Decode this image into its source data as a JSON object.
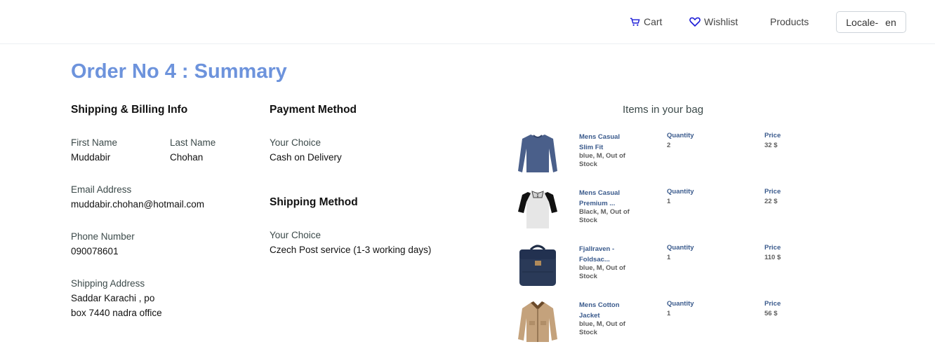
{
  "nav": {
    "cart_label": "Cart",
    "wishlist_label": "Wishlist",
    "products_label": "Products",
    "locale_label": "Locale-",
    "locale_value": "en"
  },
  "page": {
    "title": "Order No 4 : Summary"
  },
  "shipping_billing": {
    "heading": "Shipping & Billing Info",
    "first_name_label": "First Name",
    "first_name": "Muddabir",
    "last_name_label": "Last Name",
    "last_name": "Chohan",
    "email_label": "Email Address",
    "email": "muddabir.chohan@hotmail.com",
    "phone_label": "Phone Number",
    "phone": "090078601",
    "address_label": "Shipping Address",
    "address_line1": "Saddar Karachi , po",
    "address_line2": "box 7440 nadra office"
  },
  "payment": {
    "heading": "Payment Method",
    "choice_label": "Your Choice",
    "choice": "Cash on Delivery"
  },
  "shipping_method": {
    "heading": "Shipping Method",
    "choice_label": "Your Choice",
    "choice": "Czech Post service (1-3 working days)"
  },
  "bag": {
    "title": "Items in your bag",
    "quantity_label": "Quantity",
    "price_label": "Price",
    "items": [
      {
        "name_line1": "Mens Casual",
        "name_line2": "Slim Fit",
        "meta_line1": "blue, M, Out of",
        "meta_line2": "Stock",
        "quantity": "2",
        "price": "32 $",
        "image": "shirt-icon"
      },
      {
        "name_line1": "Mens Casual",
        "name_line2": "Premium ...",
        "meta_line1": "Black, M, Out of",
        "meta_line2": "Stock",
        "quantity": "1",
        "price": "22 $",
        "image": "tshirt-icon"
      },
      {
        "name_line1": "Fjallraven -",
        "name_line2": "Foldsac...",
        "meta_line1": "blue, M, Out of",
        "meta_line2": "Stock",
        "quantity": "1",
        "price": "110 $",
        "image": "backpack-icon"
      },
      {
        "name_line1": "Mens Cotton",
        "name_line2": "Jacket",
        "meta_line1": "blue, M, Out of",
        "meta_line2": "Stock",
        "quantity": "1",
        "price": "56 $",
        "image": "jacket-icon"
      }
    ]
  },
  "colors": {
    "title": "#6d93dc",
    "product_name": "#3a5a8c",
    "icon_accent": "#1a1ad6"
  }
}
